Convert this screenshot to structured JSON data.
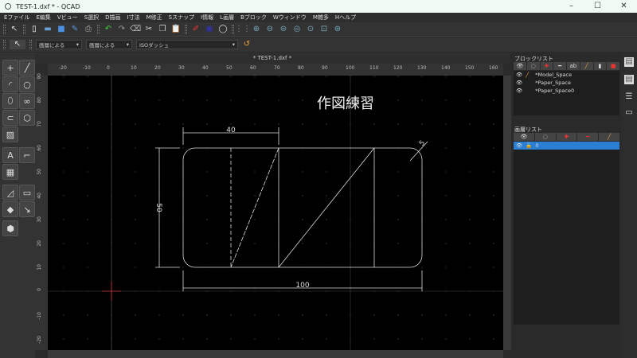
{
  "window": {
    "title": "TEST-1.dxf * - QCAD",
    "minimize": "–",
    "maximize": "☐",
    "close": "✕"
  },
  "menu": [
    "Eファイル",
    "E編集",
    "Vビュー",
    "S選択",
    "D描画",
    "I寸法",
    "M修正",
    "Sスナップ",
    "I情報",
    "L画層",
    "Bブロック",
    "Wウィンドウ",
    "M雑多",
    "Hヘルプ"
  ],
  "toolbar2": {
    "color": "画層による",
    "linetype": "画層による",
    "linetype2": "ISOダッシュ"
  },
  "document": {
    "tab_title": "* TEST-1.dxf *"
  },
  "ruler": {
    "x": [
      "-20",
      "-10",
      "0",
      "10",
      "20",
      "30",
      "40",
      "50",
      "60",
      "70",
      "80",
      "90",
      "100",
      "110",
      "120",
      "130",
      "140",
      "150",
      "160"
    ],
    "y": [
      "90",
      "80",
      "70",
      "60",
      "50",
      "40",
      "30",
      "20",
      "10",
      "0",
      "-10",
      "-20"
    ]
  },
  "drawing": {
    "title_text": "作図練習",
    "dim_top": "40",
    "dim_left": "50",
    "dim_bottom": "100",
    "dim_radius": "5"
  },
  "block_list": {
    "title": "ブロックリスト",
    "items": [
      "*Model_Space",
      "*Paper_Space",
      "*Paper_Space0"
    ]
  },
  "layer_list": {
    "title": "画層リスト",
    "items": [
      "0"
    ]
  },
  "colors": {
    "accent": "#2a7fd4",
    "canvas": "#000000"
  }
}
